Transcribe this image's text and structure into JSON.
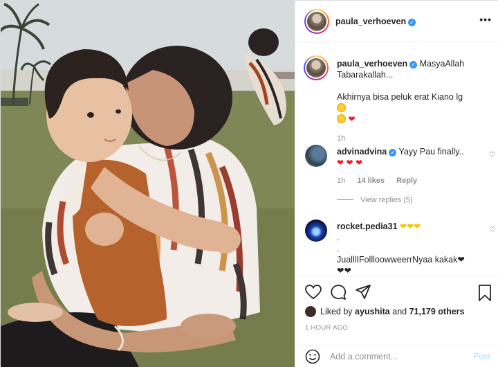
{
  "post": {
    "author": "paula_verhoeven",
    "caption_line1": "MasyaAllah",
    "caption_line2": "Tabarakallah...",
    "caption_line3": "Akhirnya bisa peluk erat Kiano lg",
    "caption_time": "1h"
  },
  "comments": [
    {
      "username": "advinadvina",
      "text": "Yayy Pau finally..",
      "time": "1h",
      "likes": "14 likes",
      "reply": "Reply",
      "view_replies": "View replies (5)"
    },
    {
      "username": "rocket.pedia31",
      "line2": ".",
      "line3": ".",
      "line4": "JualllIFollloowweerrNyaa kakak"
    }
  ],
  "liked_by": {
    "prefix": "Liked by",
    "user": "ayushita",
    "and": "and",
    "others": "71,179 others"
  },
  "time_ago": "1 HOUR AGO",
  "add_comment": {
    "placeholder": "Add a comment...",
    "post_label": "Post"
  },
  "icons": {
    "more": "more-options-icon",
    "like": "heart-icon",
    "comment": "comment-icon",
    "share": "paper-plane-icon",
    "save": "bookmark-icon",
    "emoji": "emoji-icon",
    "verified": "verified-badge-icon"
  },
  "colors": {
    "verified": "#3897f0",
    "post_button": "#b2dffc",
    "muted": "#8e8e8e"
  }
}
